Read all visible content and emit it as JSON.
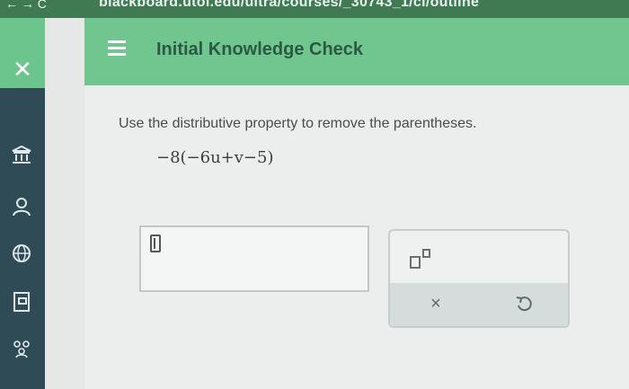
{
  "browser": {
    "nav_text": "←  →  C",
    "url": "blackboard.utol.edu/ultra/courses/_30743_1/cl/outline"
  },
  "header": {
    "menu_icon": "hamburger-menu-icon",
    "title": "Initial Knowledge Check"
  },
  "rail": {
    "close_icon": "close-icon",
    "items": [
      {
        "icon": "institution-icon"
      },
      {
        "icon": "profile-icon"
      },
      {
        "icon": "globe-icon"
      },
      {
        "icon": "courses-icon"
      },
      {
        "icon": "groups-icon"
      }
    ]
  },
  "question": {
    "prompt": "Use the distributive property to remove the parentheses.",
    "expression": "−8(−6u+v−5)"
  },
  "answer": {
    "value": ""
  },
  "keypad": {
    "exponent_icon": "exponent-icon",
    "clear_label": "×",
    "undo_icon": "undo-icon"
  },
  "colors": {
    "accent": "#71c690",
    "rail": "#2f4c56",
    "title": "#2b5944"
  }
}
